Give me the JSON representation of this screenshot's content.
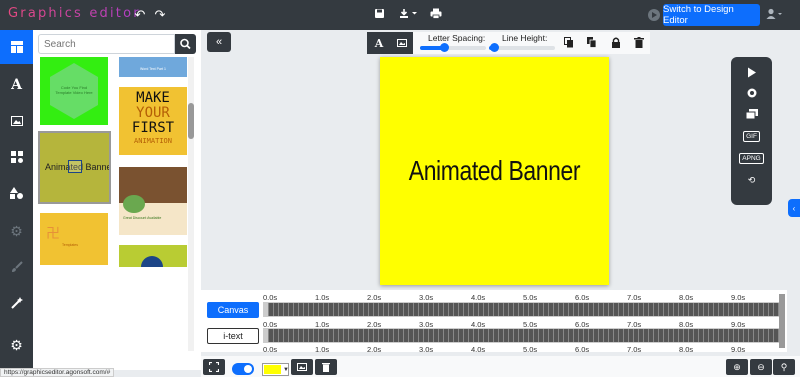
{
  "app": {
    "title": "Graphics editor",
    "switch_label": "Switch to Design Editor"
  },
  "search": {
    "placeholder": "Search"
  },
  "templates": [
    {
      "text": "Code You Find Template Video Here",
      "bg": "#22cc22"
    },
    {
      "text": "Word Text Part 1",
      "bg": "#6fa8dc"
    },
    {
      "lines": [
        "MAKE",
        "YOUR",
        "FIRST",
        "ANIMATION"
      ],
      "bg": "#f1c232"
    },
    {
      "text": "Animated Banner",
      "bg": "#b5b53c"
    },
    {
      "text": "Great Discount Available",
      "bg": "#f5e6c8"
    },
    {
      "text": "Templates",
      "bg": "#f1c232"
    },
    {
      "text": "",
      "bg": "#b9cc33"
    }
  ],
  "toolbar": {
    "letter_spacing_label": "Letter Spacing:",
    "line_height_label": "Line Height:",
    "letter_spacing_value": 0.35,
    "line_height_value": 0.0
  },
  "canvas": {
    "text": "Animated Banner",
    "bg": "#ffff00"
  },
  "anim_panel": {
    "gif_label": "GIF",
    "apng_label": "APNG"
  },
  "timeline": {
    "canvas_label": "Canvas",
    "itext_label": "i-text",
    "ticks": [
      "0.0s",
      "1.0s",
      "2.0s",
      "3.0s",
      "4.0s",
      "5.0s",
      "6.0s",
      "7.0s",
      "8.0s",
      "9.0s"
    ]
  },
  "status": {
    "url": "https://graphicseditor.agonsoft.com/#"
  },
  "colors": {
    "accent": "#0d6efd",
    "dark": "#343a40",
    "fill_swatch": "#ffff00"
  }
}
